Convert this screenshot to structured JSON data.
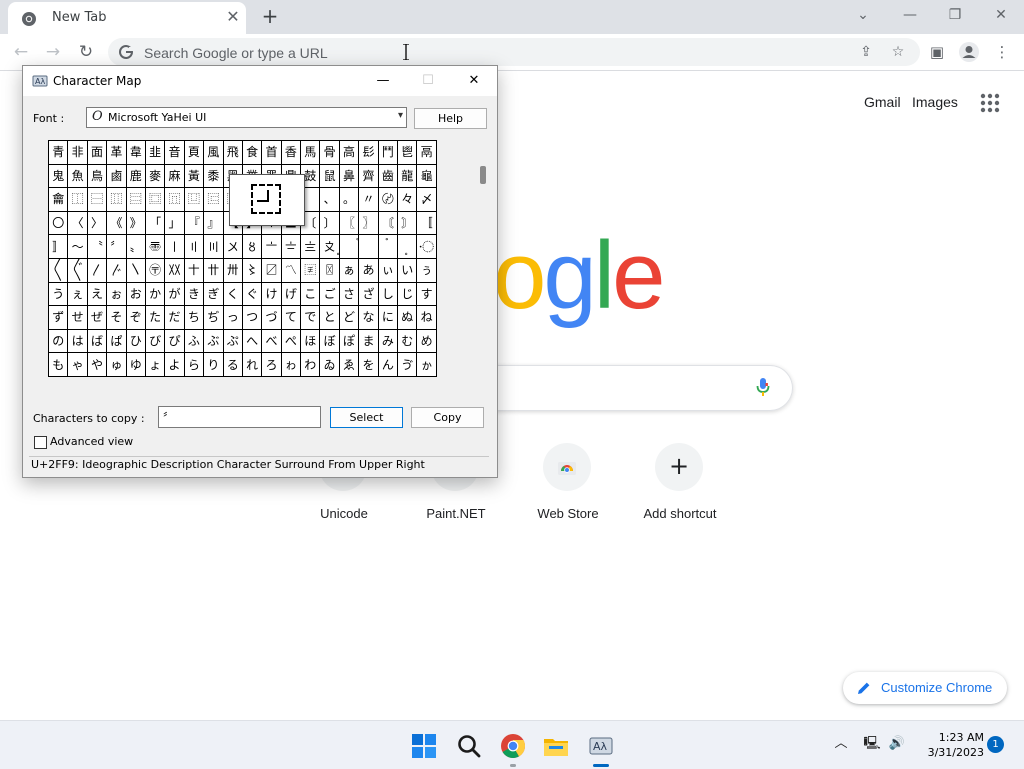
{
  "browser": {
    "tab": {
      "title": "New Tab"
    },
    "omnibox": {
      "placeholder": "Search Google or type a URL"
    }
  },
  "ntp": {
    "links": {
      "gmail": "Gmail",
      "images": "Images"
    },
    "logo_letters": [
      "o",
      "g",
      "l",
      "e"
    ],
    "logo_colors": {
      "blue": "#4285f4",
      "red": "#ea4335",
      "yellow": "#fbbc05",
      "green": "#34a853"
    },
    "shortcuts": [
      "Unicode",
      "Paint.NET",
      "Web Store",
      "Add shortcut"
    ],
    "customize_label": "Customize Chrome"
  },
  "charmap": {
    "title": "Character Map",
    "font_label": "Font :",
    "font_value": "Microsoft YaHei UI",
    "help_label": "Help",
    "grid_rows": [
      [
        "青",
        "非",
        "面",
        "革",
        "韋",
        "韭",
        "音",
        "頁",
        "風",
        "飛",
        "食",
        "首",
        "香",
        "馬",
        "骨",
        "高",
        "髟",
        "鬥",
        "鬯",
        "鬲"
      ],
      [
        "鬼",
        "魚",
        "鳥",
        "鹵",
        "鹿",
        "麥",
        "麻",
        "黃",
        "黍",
        "黑",
        "黹",
        "黽",
        "鼎",
        "鼓",
        "鼠",
        "鼻",
        "齊",
        "齒",
        "龍",
        "龜"
      ],
      [
        "龠",
        "⿰",
        "⿱",
        "⿲",
        "⿳",
        "⿴",
        "⿵",
        "⿶",
        "⿷",
        "⿸",
        "⿹",
        "⿺",
        "⿻",
        "　",
        "、",
        "。",
        "〃",
        "〄",
        "々",
        "〆"
      ],
      [
        "〇",
        "〈",
        "〉",
        "《",
        "》",
        "「",
        "」",
        "『",
        "』",
        "【",
        "】",
        "〒",
        "〓",
        "〔",
        "〕",
        "〖",
        "〗",
        "〘",
        "〙",
        "〚"
      ],
      [
        "〛",
        "〜",
        "〝",
        "〞",
        "〟",
        "〠",
        "〡",
        "〢",
        "〣",
        "〤",
        "〥",
        "〦",
        "〧",
        "〨",
        "〩",
        "〪",
        "〫",
        "〬",
        "〭",
        "〮"
      ],
      [
        "〱",
        "〲",
        "〳",
        "〴",
        "〵",
        "〶",
        "〷",
        "〸",
        "〹",
        "〺",
        "〻",
        "〼",
        "〽",
        "〾",
        "〿",
        "ぁ",
        "あ",
        "ぃ",
        "い",
        "ぅ"
      ],
      [
        "う",
        "ぇ",
        "え",
        "ぉ",
        "お",
        "か",
        "が",
        "き",
        "ぎ",
        "く",
        "ぐ",
        "け",
        "げ",
        "こ",
        "ご",
        "さ",
        "ざ",
        "し",
        "じ",
        "す"
      ],
      [
        "ず",
        "せ",
        "ぜ",
        "そ",
        "ぞ",
        "た",
        "だ",
        "ち",
        "ぢ",
        "っ",
        "つ",
        "づ",
        "て",
        "で",
        "と",
        "ど",
        "な",
        "に",
        "ぬ",
        "ね"
      ],
      [
        "の",
        "は",
        "ば",
        "ぱ",
        "ひ",
        "び",
        "ぴ",
        "ふ",
        "ぶ",
        "ぷ",
        "へ",
        "べ",
        "ぺ",
        "ほ",
        "ぼ",
        "ぽ",
        "ま",
        "み",
        "む",
        "め"
      ],
      [
        "も",
        "ゃ",
        "や",
        "ゅ",
        "ゆ",
        "ょ",
        "よ",
        "ら",
        "り",
        "る",
        "れ",
        "ろ",
        "ゎ",
        "わ",
        "ゐ",
        "ゑ",
        "を",
        "ん",
        "ゔ",
        "ゕ"
      ]
    ],
    "copy_label": "Characters to copy :",
    "copy_value": "〞",
    "select_label": "Select",
    "copy_button_label": "Copy",
    "advanced_label": "Advanced view",
    "status": "U+2FF9: Ideographic Description Character Surround From Upper Right"
  },
  "taskbar": {
    "time": "1:23 AM",
    "date": "3/31/2023",
    "notification_count": "1"
  }
}
